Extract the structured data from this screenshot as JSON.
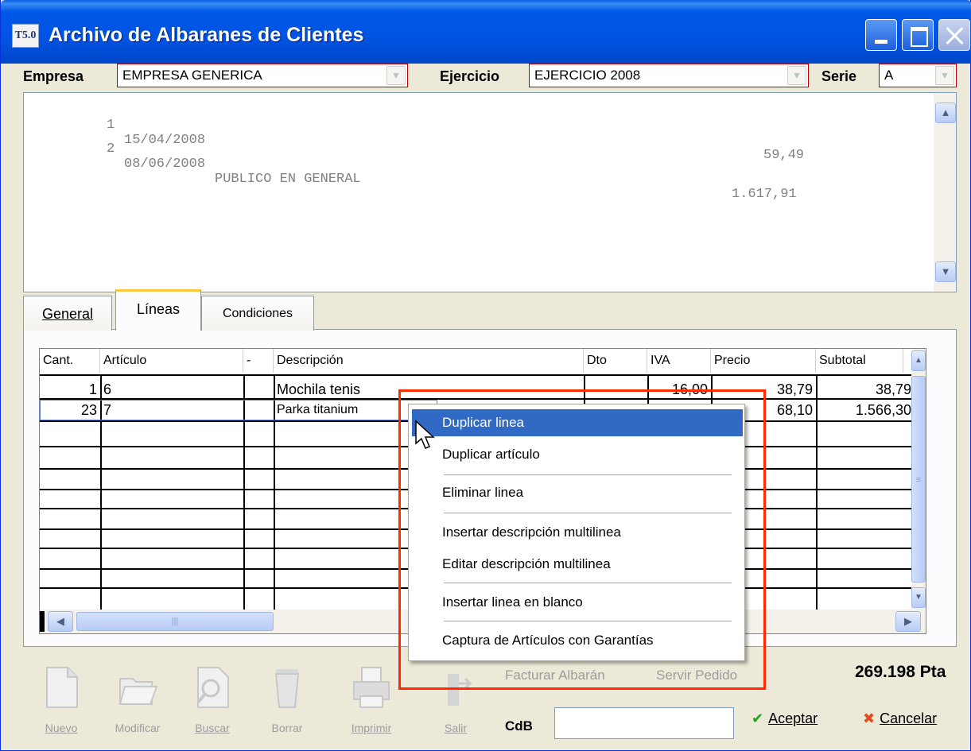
{
  "window": {
    "title": "Archivo de Albaranes de Clientes",
    "icon_text": "T5.0"
  },
  "header": {
    "empresa_label": "Empresa",
    "empresa_value": "EMPRESA GENERICA",
    "ejercicio_label": "Ejercicio",
    "ejercicio_value": "EJERCICIO 2008",
    "serie_label": "Serie",
    "serie_value": "A"
  },
  "records": [
    {
      "num": "1",
      "date": "15/04/2008",
      "client": "",
      "amount": "59,49"
    },
    {
      "num": "2",
      "date": "08/06/2008",
      "client": "PUBLICO EN GENERAL",
      "amount": "1.617,91"
    }
  ],
  "tabs": [
    {
      "label": "General"
    },
    {
      "label": "Líneas"
    },
    {
      "label": "Condiciones"
    }
  ],
  "grid": {
    "columns": [
      "Cant.",
      "Artículo",
      "-",
      "Descripción",
      "Dto",
      "IVA",
      "Precio",
      "Subtotal"
    ],
    "rows": [
      {
        "cant": "1",
        "articulo": "6",
        "descripcion": "Mochila tenis",
        "iva": "16,00",
        "precio": "38,79",
        "subtotal": "38,79"
      },
      {
        "cant": "23",
        "articulo": "7",
        "descripcion": "Parka titanium",
        "precio": "68,10",
        "subtotal": "1.566,30"
      }
    ]
  },
  "context_menu": {
    "items": [
      "Duplicar linea",
      "Duplicar artículo",
      "Eliminar linea",
      "Insertar descripción multilinea",
      "Editar descripción multilinea",
      "Insertar linea en blanco",
      "Captura de Artículos con Garantías"
    ]
  },
  "toolbar": {
    "nuevo": "Nuevo",
    "modificar": "Modificar",
    "buscar": "Buscar",
    "borrar": "Borrar",
    "imprimir": "Imprimir",
    "salir": "Salir"
  },
  "links": {
    "facturar": "Facturar Albarán",
    "servir": "Servir Pedido"
  },
  "footer": {
    "total": "269.198 Pta",
    "cdb_label": "CdB",
    "aceptar": "Aceptar",
    "cancelar": "Cancelar"
  },
  "colors": {
    "titlebar": "#0054e3",
    "menu_highlight": "#316ac5",
    "callout_border": "#ff2a00",
    "tab_accent": "#ffc73c"
  }
}
